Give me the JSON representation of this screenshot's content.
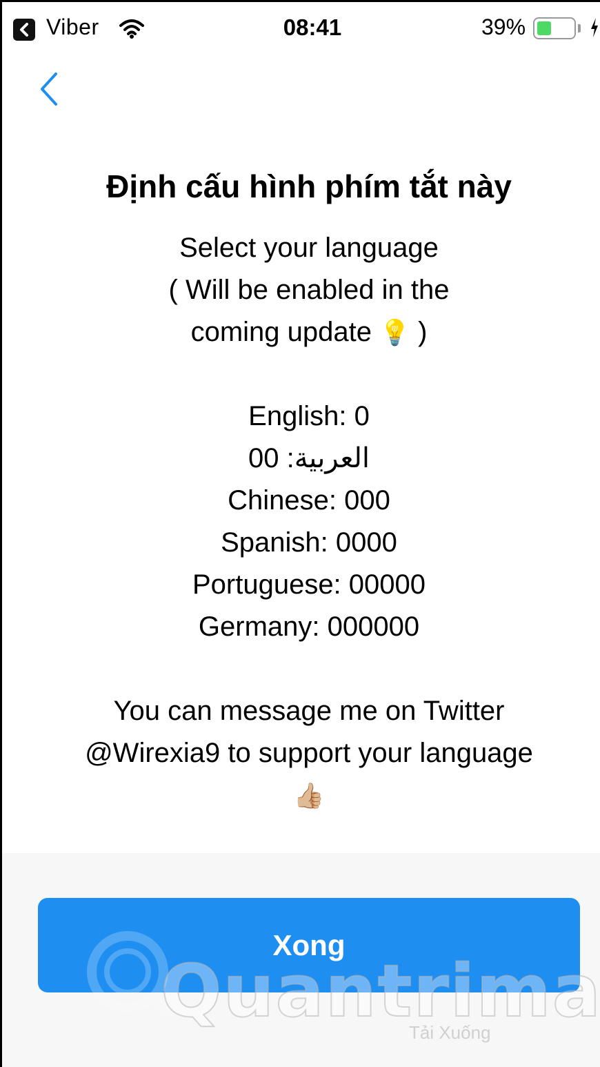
{
  "status_bar": {
    "app_name": "Viber",
    "time": "08:41",
    "battery_percent_label": "39%",
    "battery_level": 0.39,
    "icons": [
      "back-to-app-icon",
      "wifi-icon",
      "battery-icon",
      "charging-bolt-icon"
    ]
  },
  "nav": {
    "back_icon": "chevron-left-icon",
    "accent_color": "#1f8ef1"
  },
  "content": {
    "title": "Định cấu hình phím tắt này",
    "subtitle_lines": [
      "Select your language",
      "( Will be enabled in the",
      "coming update"
    ],
    "subtitle_emoji": "💡",
    "subtitle_close": ")",
    "languages": [
      "English: 0",
      "العربية: 00",
      "Chinese: 000",
      "Spanish: 0000",
      "Portuguese: 00000",
      "Germany: 000000"
    ],
    "support_lines": [
      "You can message me on Twitter",
      "@Wirexia9 to support your language"
    ],
    "support_emoji": "👍🏼"
  },
  "footer": {
    "done_label": "Xong",
    "button_color": "#1f8ef1"
  },
  "watermark": {
    "brand": "Quantrimang",
    "sub": "Tải Xuống"
  }
}
